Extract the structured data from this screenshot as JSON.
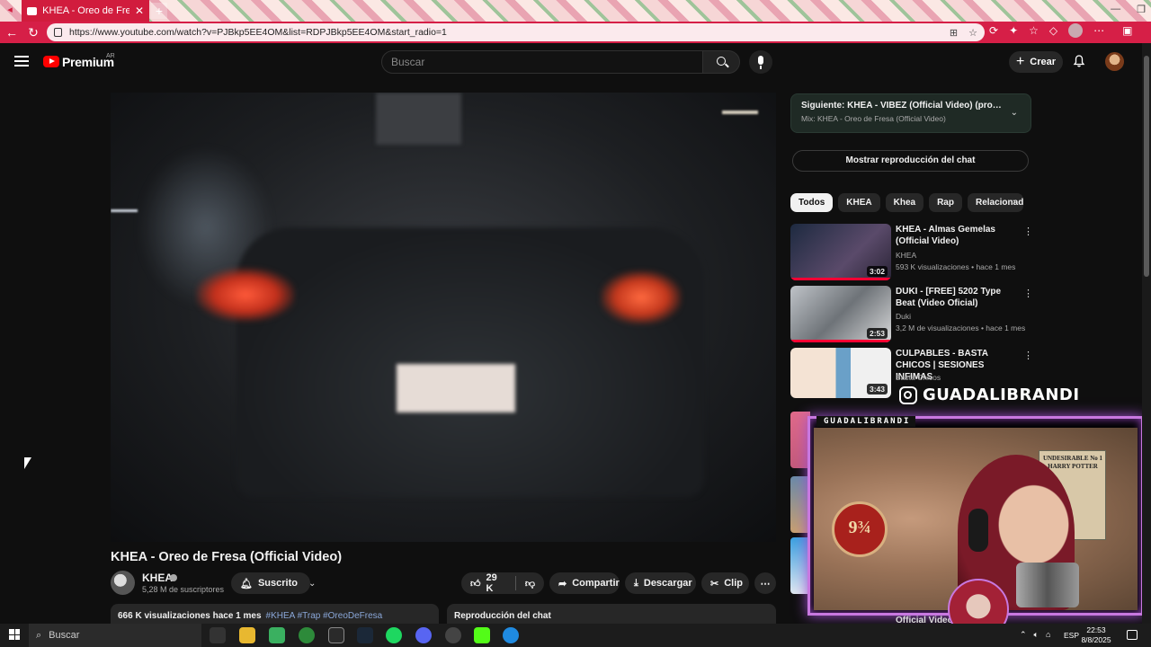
{
  "browser": {
    "tab_title": "KHEA - Oreo de Fresa (Offic",
    "tab_close": "✕",
    "new_tab": "+",
    "url": "https://www.youtube.com/watch?v=PJBkp5EE4OM&list=RDPJBkp5EE4OM&start_radio=1"
  },
  "youtube": {
    "brand": "Premium",
    "country": "AR",
    "search_placeholder": "Buscar",
    "create_label": "Crear"
  },
  "video": {
    "title": "KHEA - Oreo de Fresa (Official Video)",
    "channel": "KHEA",
    "subscribers": "5,28 M de suscriptores",
    "subscribed_label": "Suscrito",
    "likes": "29 K",
    "share_label": "Compartir",
    "download_label": "Descargar",
    "clip_label": "Clip",
    "views_date": "666 K visualizaciones  hace 1 mes",
    "hashtags": "#KHEA #Trap #OreoDeFresa",
    "chat_replay_label": "Reproducción del chat"
  },
  "sidebar": {
    "next_line1": "Siguiente: KHEA - VIBEZ (Official Video) (prod. Awe...",
    "next_line2": "Mix: KHEA - Oreo de Fresa (Official Video)",
    "show_chat_label": "Mostrar reproducción del chat",
    "chips": [
      "Todos",
      "KHEA",
      "Khea",
      "Rap",
      "Relacionado"
    ],
    "recommendations": [
      {
        "title": "KHEA - Almas Gemelas (Official Video)",
        "channel": "KHEA",
        "meta": "593 K visualizaciones • hace 1 mes",
        "duration": "3:02"
      },
      {
        "title": "DUKI - [FREE] 5202 Type Beat (Video Oficial)",
        "channel": "Duki",
        "meta": "3,2 M de visualizaciones • hace 1 mes",
        "duration": "2:53"
      },
      {
        "title": "CULPABLES - BASTA CHICOS | SESIONES INFIMAS",
        "channel": "Basta Chicos",
        "meta": "",
        "duration": "3:43"
      }
    ]
  },
  "overlay": {
    "instagram_handle": "GUADALIBRANDI",
    "webcam_label": "GUADALIBRANDI",
    "poster_text": "UNDESIRABLE No 1 HARRY POTTER",
    "badge_text": "9¾",
    "bottom_text": "Official Video"
  },
  "taskbar": {
    "search_label": "Buscar",
    "language": "ESP",
    "time": "22:53",
    "date": "8/8/2025"
  },
  "colors": {
    "youtube_red": "#ff0000",
    "browser_accent": "#d61f47",
    "overlay_glow": "#c878e0"
  }
}
